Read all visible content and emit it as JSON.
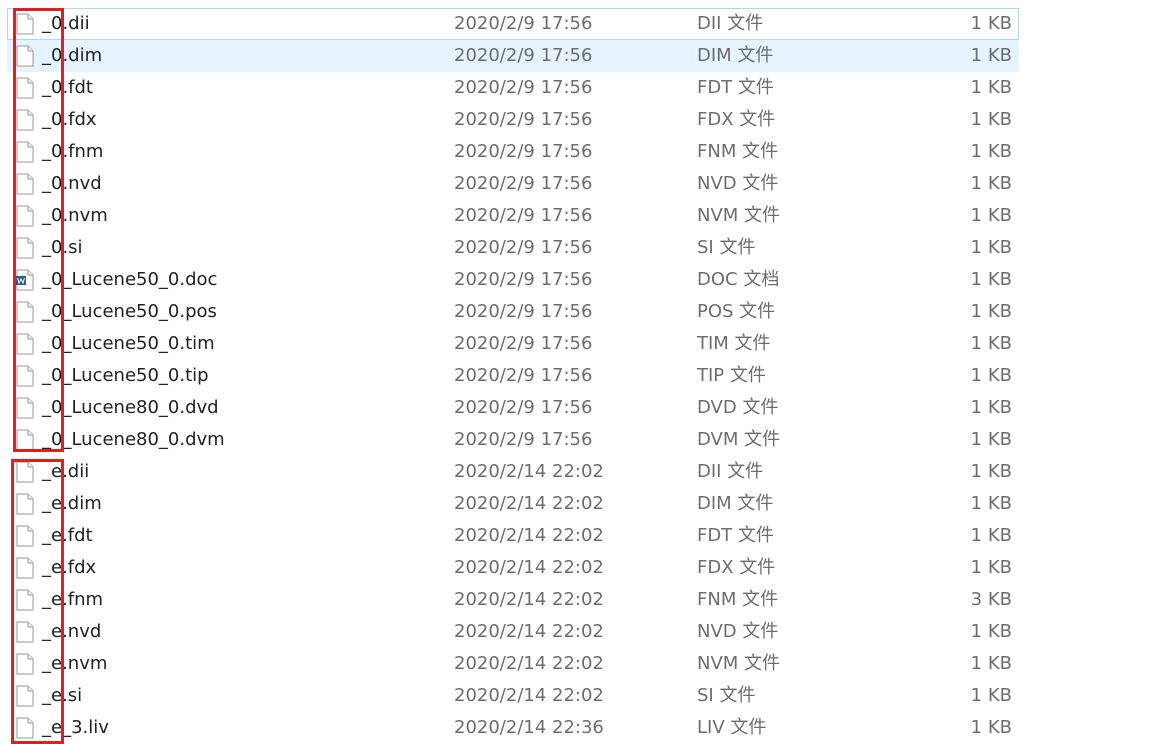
{
  "files": [
    {
      "name": "_0.dii",
      "date": "2020/2/9 17:56",
      "type": "DII 文件",
      "size": "1 KB",
      "icon": "blank-file-icon"
    },
    {
      "name": "_0.dim",
      "date": "2020/2/9 17:56",
      "type": "DIM 文件",
      "size": "1 KB",
      "icon": "blank-file-icon"
    },
    {
      "name": "_0.fdt",
      "date": "2020/2/9 17:56",
      "type": "FDT 文件",
      "size": "1 KB",
      "icon": "blank-file-icon"
    },
    {
      "name": "_0.fdx",
      "date": "2020/2/9 17:56",
      "type": "FDX 文件",
      "size": "1 KB",
      "icon": "blank-file-icon"
    },
    {
      "name": "_0.fnm",
      "date": "2020/2/9 17:56",
      "type": "FNM 文件",
      "size": "1 KB",
      "icon": "blank-file-icon"
    },
    {
      "name": "_0.nvd",
      "date": "2020/2/9 17:56",
      "type": "NVD 文件",
      "size": "1 KB",
      "icon": "blank-file-icon"
    },
    {
      "name": "_0.nvm",
      "date": "2020/2/9 17:56",
      "type": "NVM 文件",
      "size": "1 KB",
      "icon": "blank-file-icon"
    },
    {
      "name": "_0.si",
      "date": "2020/2/9 17:56",
      "type": "SI 文件",
      "size": "1 KB",
      "icon": "blank-file-icon"
    },
    {
      "name": "_0_Lucene50_0.doc",
      "date": "2020/2/9 17:56",
      "type": "DOC 文档",
      "size": "1 KB",
      "icon": "word-document-icon"
    },
    {
      "name": "_0_Lucene50_0.pos",
      "date": "2020/2/9 17:56",
      "type": "POS 文件",
      "size": "1 KB",
      "icon": "blank-file-icon"
    },
    {
      "name": "_0_Lucene50_0.tim",
      "date": "2020/2/9 17:56",
      "type": "TIM 文件",
      "size": "1 KB",
      "icon": "blank-file-icon"
    },
    {
      "name": "_0_Lucene50_0.tip",
      "date": "2020/2/9 17:56",
      "type": "TIP 文件",
      "size": "1 KB",
      "icon": "blank-file-icon"
    },
    {
      "name": "_0_Lucene80_0.dvd",
      "date": "2020/2/9 17:56",
      "type": "DVD 文件",
      "size": "1 KB",
      "icon": "blank-file-icon"
    },
    {
      "name": "_0_Lucene80_0.dvm",
      "date": "2020/2/9 17:56",
      "type": "DVM 文件",
      "size": "1 KB",
      "icon": "blank-file-icon"
    },
    {
      "name": "_e.dii",
      "date": "2020/2/14 22:02",
      "type": "DII 文件",
      "size": "1 KB",
      "icon": "blank-file-icon"
    },
    {
      "name": "_e.dim",
      "date": "2020/2/14 22:02",
      "type": "DIM 文件",
      "size": "1 KB",
      "icon": "blank-file-icon"
    },
    {
      "name": "_e.fdt",
      "date": "2020/2/14 22:02",
      "type": "FDT 文件",
      "size": "1 KB",
      "icon": "blank-file-icon"
    },
    {
      "name": "_e.fdx",
      "date": "2020/2/14 22:02",
      "type": "FDX 文件",
      "size": "1 KB",
      "icon": "blank-file-icon"
    },
    {
      "name": "_e.fnm",
      "date": "2020/2/14 22:02",
      "type": "FNM 文件",
      "size": "3 KB",
      "icon": "blank-file-icon"
    },
    {
      "name": "_e.nvd",
      "date": "2020/2/14 22:02",
      "type": "NVD 文件",
      "size": "1 KB",
      "icon": "blank-file-icon"
    },
    {
      "name": "_e.nvm",
      "date": "2020/2/14 22:02",
      "type": "NVM 文件",
      "size": "1 KB",
      "icon": "blank-file-icon"
    },
    {
      "name": "_e.si",
      "date": "2020/2/14 22:02",
      "type": "SI 文件",
      "size": "1 KB",
      "icon": "blank-file-icon"
    },
    {
      "name": "_e_3.liv",
      "date": "2020/2/14 22:36",
      "type": "LIV 文件",
      "size": "1 KB",
      "icon": "blank-file-icon"
    }
  ],
  "focused_row": 0,
  "selected_row": 1,
  "colors": {
    "selection": "#e5f3ff",
    "focus_border": "#b7d3ee",
    "annotation_box": "#e02020",
    "word_icon": "#2b579a"
  }
}
